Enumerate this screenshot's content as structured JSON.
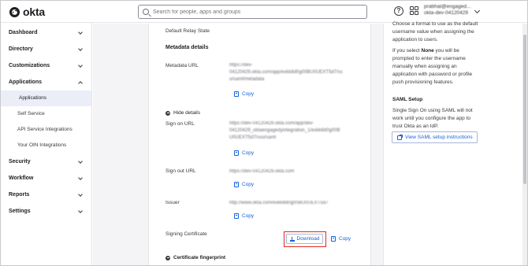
{
  "header": {
    "logo": "okta",
    "search_placeholder": "Search for people, apps and groups",
    "user_line1": "prabhat@engaged...",
    "user_line2": "okta-dev-04120429"
  },
  "sidebar": {
    "items": [
      {
        "label": "Dashboard"
      },
      {
        "label": "Directory"
      },
      {
        "label": "Customizations"
      },
      {
        "label": "Applications"
      },
      {
        "label": "Security"
      },
      {
        "label": "Workflow"
      },
      {
        "label": "Reports"
      },
      {
        "label": "Settings"
      }
    ],
    "sub_items": [
      {
        "label": "Applications"
      },
      {
        "label": "Self Service"
      },
      {
        "label": "API Service Integrations"
      },
      {
        "label": "Your OIN Integrations"
      }
    ]
  },
  "main": {
    "default_relay_state": "Default Relay State",
    "metadata_details": "Metadata details",
    "metadata_url_label": "Metadata URL",
    "metadata_url_lines": [
      "https://dev-",
      "04120429.okta.com/app/exkk8d0g00BU0UEXT5d7/ss",
      "o/saml/metadata"
    ],
    "copy": "Copy",
    "hide_details": "Hide details",
    "sign_on_url_label": "Sign on URL",
    "sign_on_url_lines": [
      "https://dev-04120429.okta.com/app/dev-",
      "04120429_oktaengagedyintegration_1/exkk8d0g00B",
      "U0UEXT5d7/sso/saml"
    ],
    "sign_out_url_label": "Sign out URL",
    "sign_out_url": "https://dev-04120429.okta.com",
    "issuer_label": "Issuer",
    "issuer": "http://www.okta.com/exkk8d0g00BU0UEXT5d7",
    "signing_cert_label": "Signing Certificate",
    "download": "Download",
    "cert_fingerprint": "Certificate fingerprint"
  },
  "right_panel": {
    "text1_lines": [
      "Choose a format to use as the default",
      "username value when assigning the",
      "application to users."
    ],
    "text2_prefix": "If you select ",
    "text2_bold": "None",
    "text2_suffix": " you will be",
    "text2_lines": [
      "prompted to enter the username",
      "manually when assigning an",
      "application with password or profile",
      "push provisioning features."
    ],
    "saml_setup_title": "SAML Setup",
    "saml_setup_lines": [
      "Single Sign On using SAML will not",
      "work until you configure the app to",
      "trust Okta as an IdP."
    ],
    "saml_button": "View SAML setup instructions"
  },
  "colors": {
    "accent": "#1662dd",
    "highlight_border": "#e0281b",
    "active_nav_bg": "#ebedf7"
  }
}
